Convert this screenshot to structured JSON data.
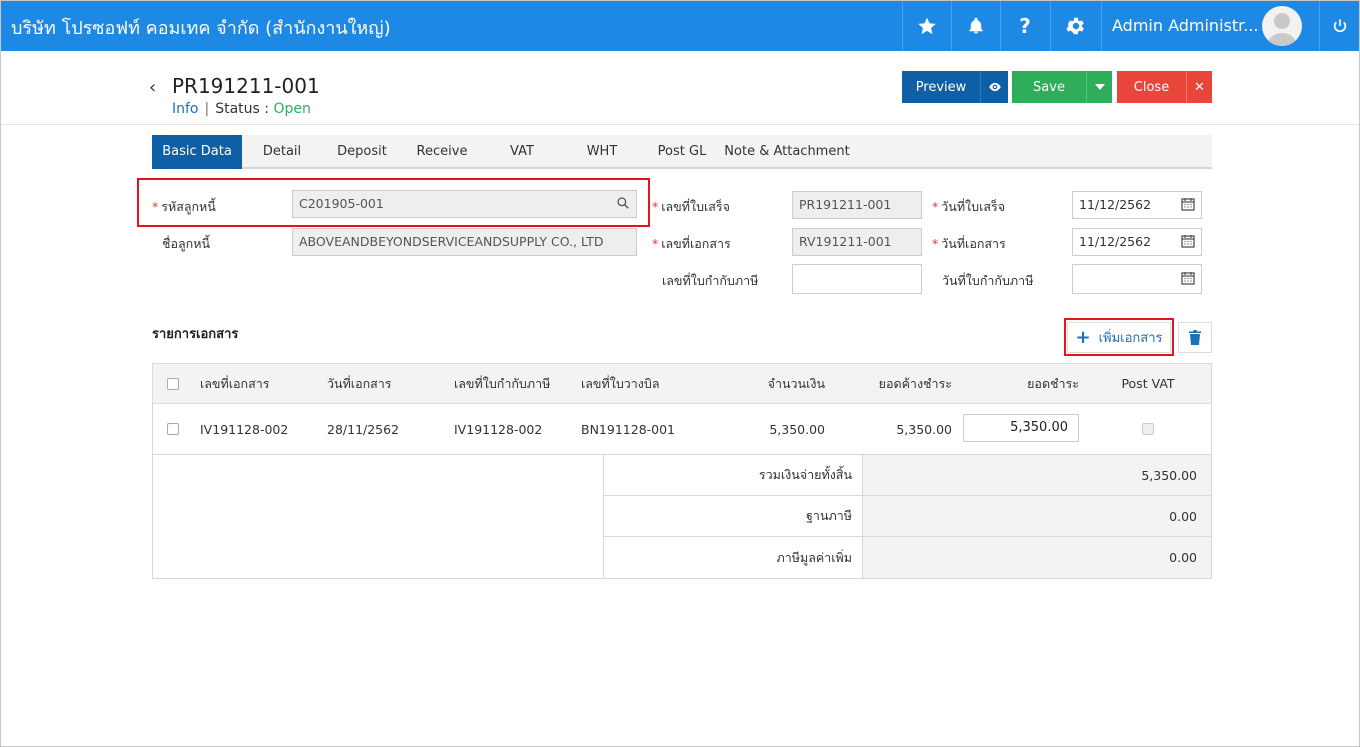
{
  "app": {
    "company": "บริษัท โปรซอฟท์ คอมเทค จำกัด (สำนักงานใหญ่)",
    "user_name": "Admin Administr...",
    "icons": [
      "star-icon",
      "bell-icon",
      "help-icon",
      "gear-icon",
      "power-icon"
    ]
  },
  "header": {
    "doc_no": "PR191211-001",
    "info_label": "Info",
    "status_label": "Status",
    "status_colon": ":",
    "status_value": "Open"
  },
  "toolbar": {
    "preview": "Preview",
    "save": "Save",
    "close": "Close"
  },
  "tabs": [
    "Basic Data",
    "Detail",
    "Deposit",
    "Receive",
    "VAT",
    "WHT",
    "Post GL",
    "Note & Attachment"
  ],
  "form": {
    "debtor_code_label": "รหัสลูกหนี้",
    "debtor_code_value": "C201905-001",
    "debtor_name_label": "ชื่อลูกหนี้",
    "debtor_name_value": "ABOVEANDBEYONDSERVICEANDSUPPLY CO., LTD",
    "receipt_no_label": "เลขที่ใบเสร็จ",
    "receipt_no_value": "PR191211-001",
    "document_no_label": "เลขที่เอกสาร",
    "document_no_value": "RV191211-001",
    "tax_invoice_no_label": "เลขที่ใบกำกับภาษี",
    "tax_invoice_no_value": "",
    "receipt_date_label": "วันที่ใบเสร็จ",
    "receipt_date_value": "11/12/2562",
    "document_date_label": "วันที่เอกสาร",
    "document_date_value": "11/12/2562",
    "tax_invoice_date_label": "วันที่ใบกำกับภาษี",
    "tax_invoice_date_value": ""
  },
  "documents": {
    "title": "รายการเอกสาร",
    "add_label": "เพิ่มเอกสาร",
    "columns": [
      "เลขที่เอกสาร",
      "วันที่เอกสาร",
      "เลขที่ใบกำกับภาษี",
      "เลขที่ใบวางบิล",
      "จำนวนเงิน",
      "ยอดค้างชำระ",
      "ยอดชำระ",
      "Post VAT"
    ],
    "rows": [
      {
        "doc_no": "IV191128-002",
        "doc_date": "28/11/2562",
        "tax_invoice_no": "IV191128-002",
        "billing_no": "BN191128-001",
        "amount": "5,350.00",
        "outstanding": "5,350.00",
        "payment": "5,350.00"
      }
    ],
    "summary": [
      {
        "label": "รวมเงินจ่ายทั้งสิ้น",
        "value": "5,350.00"
      },
      {
        "label": "ฐานภาษี",
        "value": "0.00"
      },
      {
        "label": "ภาษีมูลค่าเพิ่ม",
        "value": "0.00"
      }
    ]
  }
}
